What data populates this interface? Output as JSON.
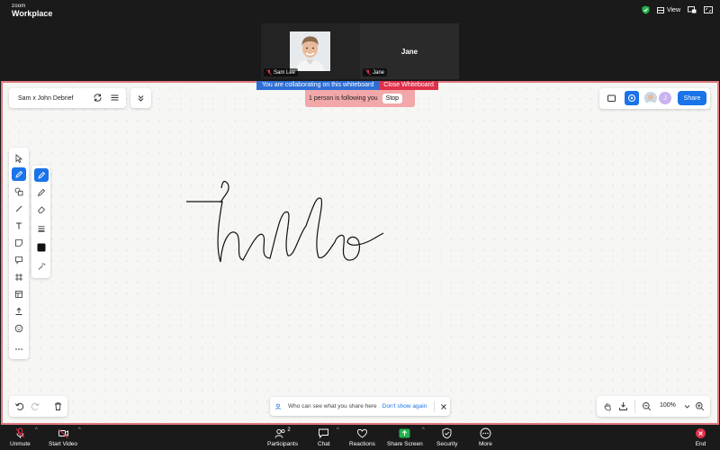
{
  "app": {
    "brand_small": "zoom",
    "brand_name": "Workplace"
  },
  "titlebar": {
    "view_label": "View"
  },
  "participants": [
    {
      "name": "Sam Lee",
      "has_video": true
    },
    {
      "name": "Jane",
      "has_video": false,
      "display_name": "Jane"
    }
  ],
  "banner": {
    "collab_text": "You are collaborating on this whiteboard",
    "close_label": "Close Whiteboard",
    "follow_text": "1 person is following you",
    "stop_label": "Stop"
  },
  "whiteboard": {
    "title": "Sam x John Debrief",
    "share_label": "Share",
    "avatar_initial": "J",
    "handwriting": "hello",
    "notice_text": "Who can see what you share here",
    "notice_link": "Don't show again",
    "zoom_level": "100%",
    "colors": {
      "accent": "#1a73e8",
      "border": "#e07a80",
      "close": "#e0304a",
      "collab": "#2d6fd6"
    }
  },
  "toolbar": {
    "tools": [
      "select-tool",
      "pen-tool",
      "shapes-tool",
      "line-tool",
      "text-tool",
      "sticky-note-tool",
      "comment-tool",
      "frame-tool",
      "template-tool",
      "upload-tool",
      "emoji-tool",
      "more-tool"
    ],
    "active_tool": "pen-tool",
    "subtools": [
      "pen",
      "highlighter",
      "eraser",
      "stroke-width",
      "color",
      "magic-pen"
    ]
  },
  "bottombar": {
    "unmute": "Unmute",
    "start_video": "Start Video",
    "participants": "Participants",
    "participants_count": "2",
    "chat": "Chat",
    "reactions": "Reactions",
    "share_screen": "Share Screen",
    "security": "Security",
    "more": "More",
    "end": "End"
  }
}
